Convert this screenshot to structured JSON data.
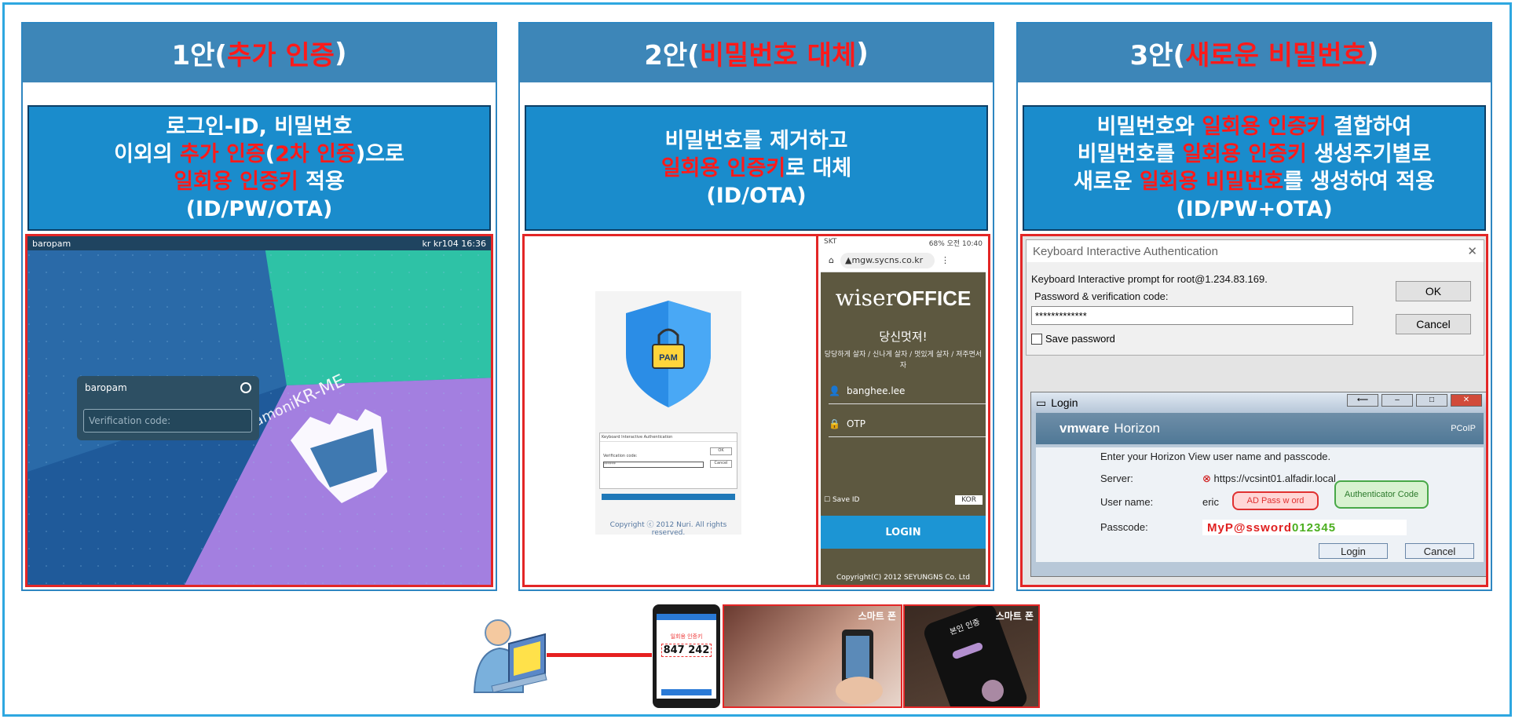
{
  "colors": {
    "frame": "#2ea7e0",
    "header": "#3d86b8",
    "desc": "#1a8ccc",
    "highlight": "#ff1a1a",
    "shot_border": "#e32626"
  },
  "panels": [
    {
      "title_prefix": "1안(",
      "title_highlight": "추가 인증",
      "title_suffix": ")",
      "desc": [
        [
          {
            "t": "로그인-ID, 비밀번호",
            "h": false
          }
        ],
        [
          {
            "t": "이외의 ",
            "h": false
          },
          {
            "t": "추가 인증",
            "h": true
          },
          {
            "t": "(",
            "h": false
          },
          {
            "t": "2차 인증",
            "h": true
          },
          {
            "t": ")으로",
            "h": false
          }
        ],
        [
          {
            "t": "일회용 인증키",
            "h": true
          },
          {
            "t": " 적용",
            "h": false
          }
        ],
        [
          {
            "t": "(ID/PW/OTA)",
            "h": false
          }
        ]
      ]
    },
    {
      "title_prefix": "2안(",
      "title_highlight": "비밀번호 대체",
      "title_suffix": ")",
      "desc": [
        [
          {
            "t": "비밀번호를 제거하고",
            "h": false
          }
        ],
        [
          {
            "t": "일회용 인증키",
            "h": true
          },
          {
            "t": "로 대체",
            "h": false
          }
        ],
        [
          {
            "t": "(ID/OTA)",
            "h": false
          }
        ]
      ]
    },
    {
      "title_prefix": "3안(",
      "title_highlight": "새로운 비밀번호",
      "title_suffix": ")",
      "desc": [
        [
          {
            "t": "비밀번호와 ",
            "h": false
          },
          {
            "t": "일회용 인증키",
            "h": true
          },
          {
            "t": " 결합하여",
            "h": false
          }
        ],
        [
          {
            "t": "비밀번호를 ",
            "h": false
          },
          {
            "t": "일회용 인증키",
            "h": true
          },
          {
            "t": " 생성주기별로",
            "h": false
          }
        ],
        [
          {
            "t": "새로운 ",
            "h": false
          },
          {
            "t": "일회용 비밀번호",
            "h": true
          },
          {
            "t": "를 생성하여 적용",
            "h": false
          }
        ],
        [
          {
            "t": "(ID/PW+OTA)",
            "h": false
          }
        ]
      ]
    }
  ],
  "desktop": {
    "host": "baropam",
    "tray": "kr  kr104  16:36",
    "login_user": "baropam",
    "placeholder": "Verification code:",
    "brand_prefix": "Hamoni",
    "brand_suffix": "KR-ME"
  },
  "pam": {
    "badge": "PAM",
    "dialog_title": "Keyboard Interactive Authentication",
    "dialog_label": "Verification code:",
    "dialog_value": "******",
    "ok": "OK",
    "cancel": "Cancel",
    "copyright": "Copyright ⓒ 2012 Nuri. All rights reserved."
  },
  "phone": {
    "carrier": "SKT",
    "status_right": "68% 오전 10:40",
    "url": "mgw.sycns.co.kr",
    "brand_light": "wiser",
    "brand_bold": "OFFICE",
    "slogan": "당신멋져!",
    "subline": "당당하게 살자 / 신나게 살자 / 멋있게 살자 / 져주면서 자",
    "user": "banghee.lee",
    "otp": "OTP",
    "save_id": "Save ID",
    "lang": "KOR",
    "login": "LOGIN",
    "footer": "Copyright(C) 2012 SEYUNGNS Co. Ltd"
  },
  "win": {
    "title": "Keyboard Interactive Authentication",
    "prompt": "Keyboard Interactive prompt for root@1.234.83.169.",
    "field_label": "Password & verification code:",
    "field_value": "*************",
    "ok": "OK",
    "cancel": "Cancel",
    "save_password": "Save password"
  },
  "vmware": {
    "window_title": "Login",
    "brand": "vmware",
    "product": "Horizon",
    "protocol": "PCoIP",
    "intro": "Enter your Horizon View user name and passcode.",
    "server_label": "Server:",
    "server_value": "https://vcsint01.alfadir.local",
    "user_label": "User name:",
    "user_value": "eric",
    "passcode_label": "Passcode:",
    "pass_part": "MyP@ssword",
    "code_part": "012345",
    "bubble_ad": "AD Pass w ord",
    "bubble_auth": "Authenticator Code",
    "login": "Login",
    "cancel": "Cancel"
  },
  "bottom": {
    "otp_label": "일회용 인증키",
    "otp_code": "847 242",
    "photo1_label": "스마트 폰",
    "photo2_label": "스마트 폰",
    "photo2_text": "본인 인증"
  }
}
